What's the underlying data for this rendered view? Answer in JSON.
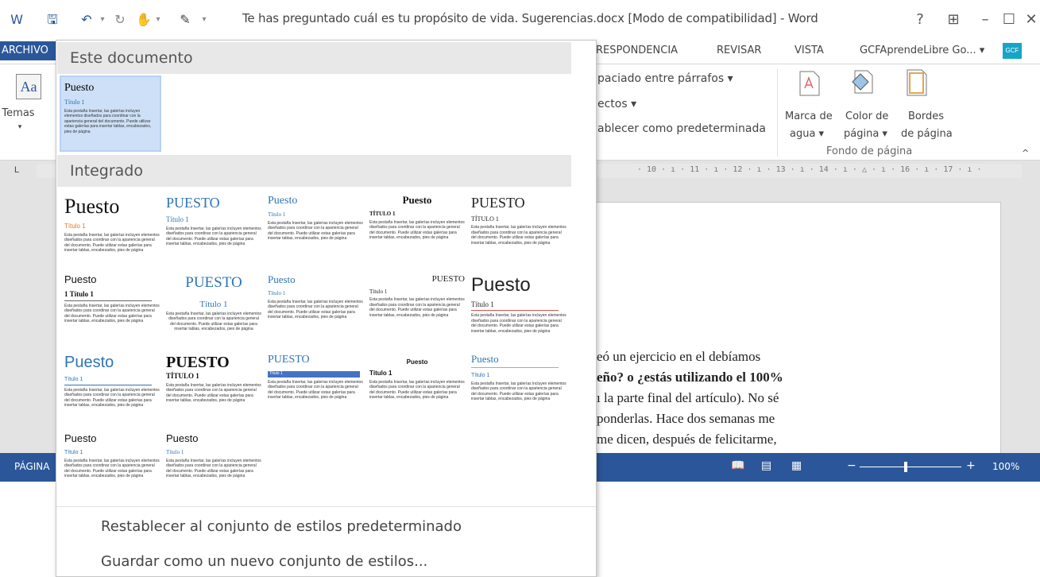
{
  "title_bar": {
    "title": "Te has preguntado cuál es tu propósito de vida. Sugerencias.docx [Modo de compatibilidad] - Word",
    "help": "?",
    "ribbon_display": "⊞",
    "minimize": "–",
    "maximize": "☐",
    "close": "✕"
  },
  "ribbon_tabs": {
    "file": "ARCHIVO",
    "mailings": "RESPONDENCIA",
    "review": "REVISAR",
    "view": "VISTA",
    "account": "GCFAprendeLibre Go... ▾",
    "avatar": "GCF"
  },
  "ribbon": {
    "themes": "Temas",
    "themes_arrow": "▾",
    "paragraph_spacing": "paciado entre párrafos ▾",
    "effects": "ectos ▾",
    "set_default": "ablecer como predeterminada",
    "watermark_l1": "Marca de",
    "watermark_l2": "agua ▾",
    "page_color_l1": "Color de",
    "page_color_l2": "página ▾",
    "page_borders_l1": "Bordes",
    "page_borders_l2": "de página",
    "group_label": "Fondo de página",
    "collapse": "^"
  },
  "ruler": {
    "corner": "L",
    "marks": "· 10 · ı · 11 · ı · 12 · ı · 13 · ı · 14 · ı · △ · ı · 16 · ı · 17 · ı ·"
  },
  "document_lines": [
    "eó un ejercicio en el debíamos",
    "eño? o ¿estás utilizando el 100%",
    "ı la parte final del artículo). No sé",
    "ponderlas. Hace dos semanas me",
    "me dicen, después de felicitarme,"
  ],
  "status_bar": {
    "page": "PÁGINA",
    "zoom": "100%",
    "zoom_fraction": 0.45,
    "zoom_minus": "−",
    "zoom_plus": "+"
  },
  "gallery": {
    "this_document_header": "Este documento",
    "builtin_header": "Integrado",
    "thumb_body": "Esta pestaña Insertar, las galerías incluyen elementos diseñados para coordinar con la apariencia general del documento. Puede utilizar estas galerías para insertar tablas, encabezados, pies de página",
    "current": {
      "title": "Puesto",
      "heading": "Título 1"
    },
    "styles": [
      {
        "title": "Puesto",
        "heading": "Título 1"
      },
      {
        "title": "PUESTO",
        "heading": "Título 1"
      },
      {
        "title": "Puesto",
        "heading": "Título 1"
      },
      {
        "title": "Puesto",
        "heading": "TÍTULO 1"
      },
      {
        "title": "PUESTO",
        "heading": "TÍTULO 1"
      },
      {
        "title": "Puesto",
        "heading": "1 Título 1"
      },
      {
        "title": "PUESTO",
        "heading": "Título 1"
      },
      {
        "title": "Puesto",
        "heading": "Título 1"
      },
      {
        "title": "PUESTO",
        "heading": "Título 1"
      },
      {
        "title": "Puesto",
        "heading": "Título 1"
      },
      {
        "title": "Puesto",
        "heading": "Título 1"
      },
      {
        "title": "PUESTO",
        "heading": "TÍTULO 1"
      },
      {
        "title": "PUESTO",
        "heading": "Título 1"
      },
      {
        "title": "Puesto",
        "heading": "Título 1"
      },
      {
        "title": "Puesto",
        "heading": "Título 1"
      },
      {
        "title": "Puesto",
        "heading": "Título 1"
      },
      {
        "title": "Puesto",
        "heading": "Título 1"
      }
    ],
    "reset_label": "Restablecer al conjunto de estilos predeterminado",
    "save_label": "Guardar como un nuevo conjunto de estilos..."
  },
  "colors": {
    "word_blue": "#2b579a",
    "heading_orange": "#e07a22",
    "heading_blue": "#2e74b5"
  }
}
